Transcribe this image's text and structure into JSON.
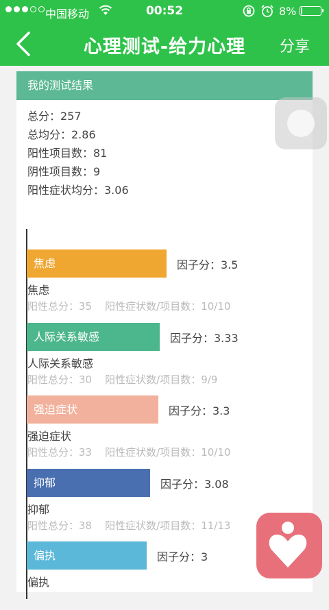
{
  "status_bar": {
    "carrier": "中国移动",
    "time": "00:52",
    "battery_percent": "8%"
  },
  "nav": {
    "title": "心理测试-给力心理",
    "share_label": "分享"
  },
  "card": {
    "header": "我的测试结果",
    "summary": [
      "总分：257",
      "总均分：2.86",
      "阳性项目数：81",
      "阴性项目数：9",
      "阳性症状均分：3.06"
    ]
  },
  "chart_data": {
    "type": "bar",
    "orientation": "horizontal",
    "categories": [
      "焦虑",
      "人际关系敏感",
      "强迫症状",
      "抑郁",
      "偏执"
    ],
    "values": [
      3.5,
      3.33,
      3.3,
      3.08,
      3
    ],
    "score_labels": [
      "因子分：3.5",
      "因子分：3.33",
      "因子分：3.3",
      "因子分：3.08",
      "因子分：3"
    ],
    "details": [
      "阳性总分：35    阳性症状数/项目数：10/10",
      "阳性总分：30    阳性症状数/项目数：9/9",
      "阳性总分：33    阳性症状数/项目数：10/10",
      "阳性总分：38    阳性症状数/项目数：11/13",
      ""
    ],
    "colors": [
      "#f0a732",
      "#4cb68c",
      "#f2b19c",
      "#4a6fb0",
      "#5bb8d8"
    ]
  }
}
